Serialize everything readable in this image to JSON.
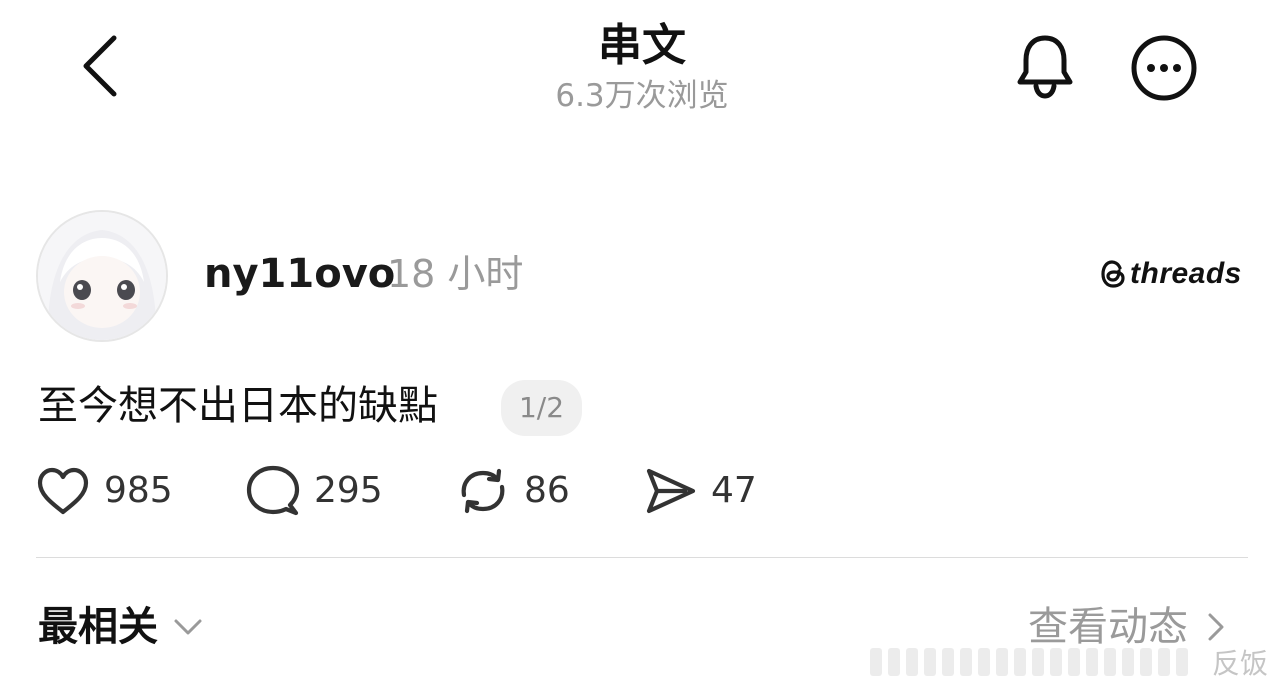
{
  "header": {
    "title": "串文",
    "views": "6.3万次浏览",
    "back_icon": "chevron-left-icon",
    "bell_icon": "bell-icon",
    "more_icon": "more-horizontal-icon"
  },
  "post": {
    "username": "ny11ovo",
    "time": "18 小时",
    "brand": "threads",
    "text": "至今想不出日本的缺點",
    "thread_position": "1/2",
    "actions": {
      "likes": "985",
      "comments": "295",
      "reposts": "86",
      "shares": "47"
    }
  },
  "footer": {
    "sort_label": "最相关",
    "view_activity": "查看动态",
    "watermark": "反饭"
  }
}
